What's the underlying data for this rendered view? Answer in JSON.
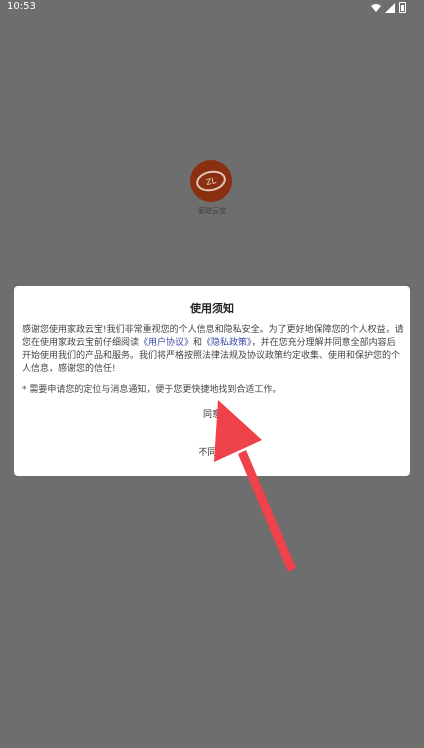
{
  "status_bar": {
    "time": "10:53"
  },
  "app": {
    "logo_text": "ZL",
    "name": "家政云宝"
  },
  "dialog": {
    "title": "使用须知",
    "body_part1": "感谢您使用家政云宝!我们非常重视您的个人信息和隐私安全。为了更好地保障您的个人权益，请您在使用家政云宝前仔细阅读",
    "user_agreement_link": "《用户协议》",
    "and": "和",
    "privacy_policy_link": "《隐私政策》",
    "body_part2": "，并在您充分理解并同意全部内容后开始使用我们的产品和服务。我们将严格按照法律法规及协议政策约定收集、使用和保护您的个人信息，感谢您的信任!",
    "note": "* 需要申请您的定位与消息通知，便于您更快捷地找到合适工作。",
    "agree_label": "同意",
    "disagree_label": "不同意"
  },
  "colors": {
    "background": "#6e6e6e",
    "link": "#3a4aa8",
    "arrow": "#f0424a"
  }
}
